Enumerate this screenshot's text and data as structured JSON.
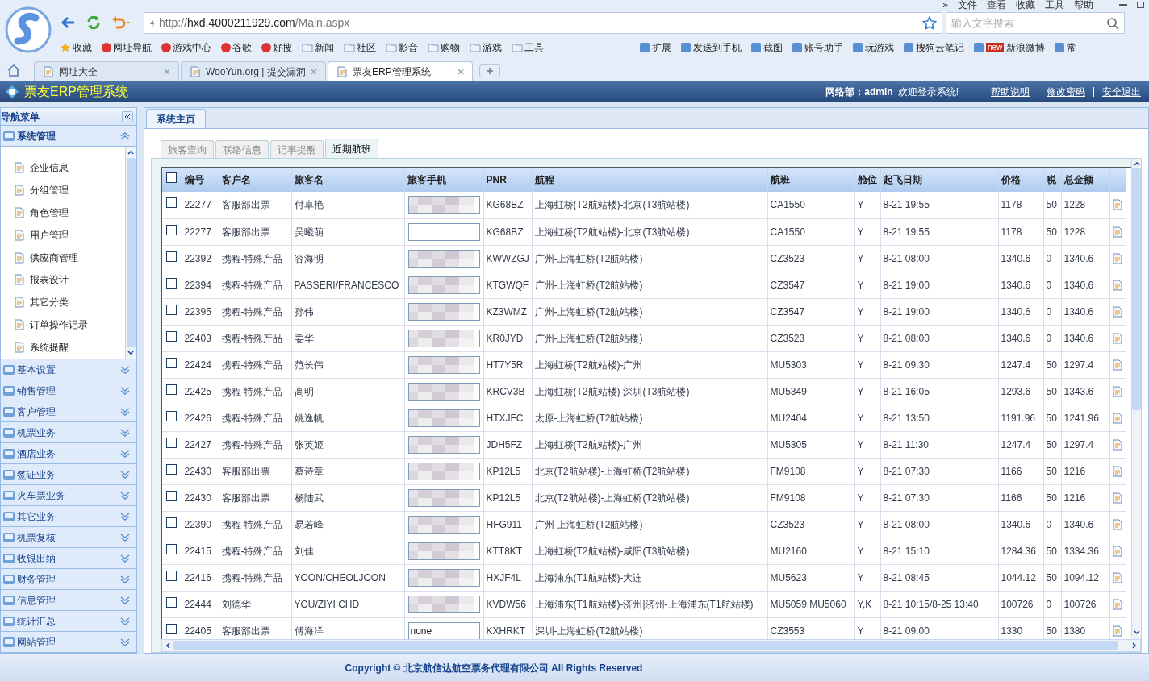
{
  "browser": {
    "menu": [
      "»",
      "文件",
      "查看",
      "收藏",
      "工具",
      "帮助"
    ],
    "url": {
      "scheme": "http://",
      "host": "hxd.4000211929.com",
      "path": "/Main.aspx"
    },
    "search": {
      "placeholder": "输入文字搜索"
    },
    "bookmarks": [
      {
        "label": "收藏",
        "kind": "star"
      },
      {
        "label": "网址导航",
        "kind": "site"
      },
      {
        "label": "游戏中心",
        "kind": "site"
      },
      {
        "label": "谷歌",
        "kind": "site"
      },
      {
        "label": "好搜",
        "kind": "site"
      },
      {
        "label": "新闻",
        "kind": "folder"
      },
      {
        "label": "社区",
        "kind": "folder"
      },
      {
        "label": "影音",
        "kind": "folder"
      },
      {
        "label": "购物",
        "kind": "folder"
      },
      {
        "label": "游戏",
        "kind": "folder"
      },
      {
        "label": "工具",
        "kind": "folder"
      }
    ],
    "tools": [
      {
        "label": "扩展"
      },
      {
        "label": "发送到手机"
      },
      {
        "label": "截图"
      },
      {
        "label": "账号助手"
      },
      {
        "label": "玩游戏"
      },
      {
        "label": "搜狗云笔记"
      },
      {
        "label": "新浪微博",
        "badge": "new"
      },
      {
        "label": "常"
      }
    ],
    "tabs": [
      {
        "label": "网址大全",
        "selected": false
      },
      {
        "label": "WooYun.org | 提交漏洞",
        "selected": false
      },
      {
        "label": "票友ERP管理系统",
        "selected": true
      }
    ]
  },
  "app": {
    "title": "票友ERP管理系统",
    "user": "网络部：admin",
    "welcome": "欢迎登录系统!",
    "links": [
      "帮助说明",
      "修改密码",
      "安全退出"
    ]
  },
  "sidebar": {
    "title": "导航菜单",
    "groups": [
      {
        "label": "系统管理",
        "expanded": true,
        "children": [
          {
            "label": "企业信息"
          },
          {
            "label": "分组管理"
          },
          {
            "label": "角色管理"
          },
          {
            "label": "用户管理"
          },
          {
            "label": "供应商管理"
          },
          {
            "label": "报表设计"
          },
          {
            "label": "其它分类"
          },
          {
            "label": "订单操作记录"
          },
          {
            "label": "系统提醒"
          }
        ]
      },
      {
        "label": "基本设置",
        "expanded": false
      },
      {
        "label": "销售管理",
        "expanded": false
      },
      {
        "label": "客户管理",
        "expanded": false
      },
      {
        "label": "机票业务",
        "expanded": false
      },
      {
        "label": "酒店业务",
        "expanded": false
      },
      {
        "label": "签证业务",
        "expanded": false
      },
      {
        "label": "火车票业务",
        "expanded": false
      },
      {
        "label": "其它业务",
        "expanded": false
      },
      {
        "label": "机票复核",
        "expanded": false
      },
      {
        "label": "收银出纳",
        "expanded": false
      },
      {
        "label": "财务管理",
        "expanded": false
      },
      {
        "label": "信息管理",
        "expanded": false
      },
      {
        "label": "统计汇总",
        "expanded": false
      },
      {
        "label": "网站管理",
        "expanded": false
      }
    ]
  },
  "page_tab": {
    "label": "系统主页",
    "selected": true
  },
  "subtabs": [
    {
      "label": "旅客查询",
      "selected": false
    },
    {
      "label": "联络信息",
      "selected": false
    },
    {
      "label": "记事提醒",
      "selected": false
    },
    {
      "label": "近期航班",
      "selected": true
    }
  ],
  "table": {
    "header_checked": false,
    "columns": [
      "编号",
      "客户名",
      "旅客名",
      "旅客手机",
      "PNR",
      "航程",
      "航班",
      "舱位",
      "起飞日期",
      "价格",
      "税",
      "总金额"
    ],
    "rows": [
      {
        "checked": false,
        "cells": [
          "22277",
          "客服部出票",
          "付卓艳",
          {
            "redacted": true
          },
          "KG68BZ",
          "上海虹桥(T2航站楼)-北京(T3航站楼)",
          "CA1550",
          "Y",
          "8-21 19:55",
          "1178",
          "50",
          "1228"
        ]
      },
      {
        "checked": false,
        "cells": [
          "22277",
          "客服部出票",
          "吴曦萌",
          {
            "redacted": false
          },
          "KG68BZ",
          "上海虹桥(T2航站楼)-北京(T3航站楼)",
          "CA1550",
          "Y",
          "8-21 19:55",
          "1178",
          "50",
          "1228"
        ]
      },
      {
        "checked": false,
        "cells": [
          "22392",
          "携程-特殊产品",
          "容海明",
          {
            "redacted": true
          },
          "KWWZGJ",
          "广州-上海虹桥(T2航站楼)",
          "CZ3523",
          "Y",
          "8-21 08:00",
          "1340.6",
          "0",
          "1340.6"
        ]
      },
      {
        "checked": false,
        "cells": [
          "22394",
          "携程-特殊产品",
          "PASSERI/FRANCESCO",
          {
            "redacted": true
          },
          "KTGWQF",
          "广州-上海虹桥(T2航站楼)",
          "CZ3547",
          "Y",
          "8-21 19:00",
          "1340.6",
          "0",
          "1340.6"
        ]
      },
      {
        "checked": false,
        "cells": [
          "22395",
          "携程-特殊产品",
          "孙伟",
          {
            "redacted": true
          },
          "KZ3WMZ",
          "广州-上海虹桥(T2航站楼)",
          "CZ3547",
          "Y",
          "8-21 19:00",
          "1340.6",
          "0",
          "1340.6"
        ]
      },
      {
        "checked": false,
        "cells": [
          "22403",
          "携程-特殊产品",
          "姜华",
          {
            "redacted": true
          },
          "KR0JYD",
          "广州-上海虹桥(T2航站楼)",
          "CZ3523",
          "Y",
          "8-21 08:00",
          "1340.6",
          "0",
          "1340.6"
        ]
      },
      {
        "checked": false,
        "cells": [
          "22424",
          "携程-特殊产品",
          "范长伟",
          {
            "redacted": true
          },
          "HT7Y5R",
          "上海虹桥(T2航站楼)-广州",
          "MU5303",
          "Y",
          "8-21 09:30",
          "1247.4",
          "50",
          "1297.4"
        ]
      },
      {
        "checked": false,
        "cells": [
          "22425",
          "携程-特殊产品",
          "高明",
          {
            "redacted": true
          },
          "KRCV3B",
          "上海虹桥(T2航站楼)-深圳(T3航站楼)",
          "MU5349",
          "Y",
          "8-21 16:05",
          "1293.6",
          "50",
          "1343.6"
        ]
      },
      {
        "checked": false,
        "cells": [
          "22426",
          "携程-特殊产品",
          "姚逸帆",
          {
            "redacted": true
          },
          "HTXJFC",
          "太原-上海虹桥(T2航站楼)",
          "MU2404",
          "Y",
          "8-21 13:50",
          "1191.96",
          "50",
          "1241.96"
        ]
      },
      {
        "checked": false,
        "cells": [
          "22427",
          "携程-特殊产品",
          "张英姬",
          {
            "redacted": true
          },
          "JDH5FZ",
          "上海虹桥(T2航站楼)-广州",
          "MU5305",
          "Y",
          "8-21 11:30",
          "1247.4",
          "50",
          "1297.4"
        ]
      },
      {
        "checked": false,
        "cells": [
          "22430",
          "客服部出票",
          "蔡诗章",
          {
            "redacted": true
          },
          "KP12L5",
          "北京(T2航站楼)-上海虹桥(T2航站楼)",
          "FM9108",
          "Y",
          "8-21 07:30",
          "1166",
          "50",
          "1216"
        ]
      },
      {
        "checked": false,
        "cells": [
          "22430",
          "客服部出票",
          "杨陆武",
          {
            "redacted": true
          },
          "KP12L5",
          "北京(T2航站楼)-上海虹桥(T2航站楼)",
          "FM9108",
          "Y",
          "8-21 07:30",
          "1166",
          "50",
          "1216"
        ]
      },
      {
        "checked": false,
        "cells": [
          "22390",
          "携程-特殊产品",
          "易若峰",
          {
            "redacted": true
          },
          "HFG911",
          "广州-上海虹桥(T2航站楼)",
          "CZ3523",
          "Y",
          "8-21 08:00",
          "1340.6",
          "0",
          "1340.6"
        ]
      },
      {
        "checked": false,
        "cells": [
          "22415",
          "携程-特殊产品",
          "刘佳",
          {
            "redacted": true
          },
          "KTT8KT",
          "上海虹桥(T2航站楼)-咸阳(T3航站楼)",
          "MU2160",
          "Y",
          "8-21 15:10",
          "1284.36",
          "50",
          "1334.36"
        ]
      },
      {
        "checked": false,
        "cells": [
          "22416",
          "携程-特殊产品",
          "YOON/CHEOLJOON",
          {
            "redacted": true
          },
          "HXJF4L",
          "上海浦东(T1航站楼)-大连",
          "MU5623",
          "Y",
          "8-21 08:45",
          "1044.12",
          "50",
          "1094.12"
        ]
      },
      {
        "checked": false,
        "cells": [
          "22444",
          "刘德华",
          "YOU/ZIYI CHD",
          {
            "redacted": true
          },
          "KVDW56",
          "上海浦东(T1航站楼)-济州|济州-上海浦东(T1航站楼)",
          "MU5059,MU5060",
          "Y,K",
          "8-21 10:15/8-25 13:40",
          "100726",
          "0",
          "100726"
        ]
      },
      {
        "checked": false,
        "cells": [
          "22405",
          "客服部出票",
          "傅海洋",
          {
            "value": "none",
            "redacted": false
          },
          "KXHRKT",
          "深圳-上海虹桥(T2航站楼)",
          "CZ3553",
          "Y",
          "8-21 09:00",
          "1330",
          "50",
          "1380"
        ]
      }
    ]
  },
  "footer": {
    "copyright": "Copyright © 北京航信达航空票务代理有限公司 All Rights Reserved"
  }
}
